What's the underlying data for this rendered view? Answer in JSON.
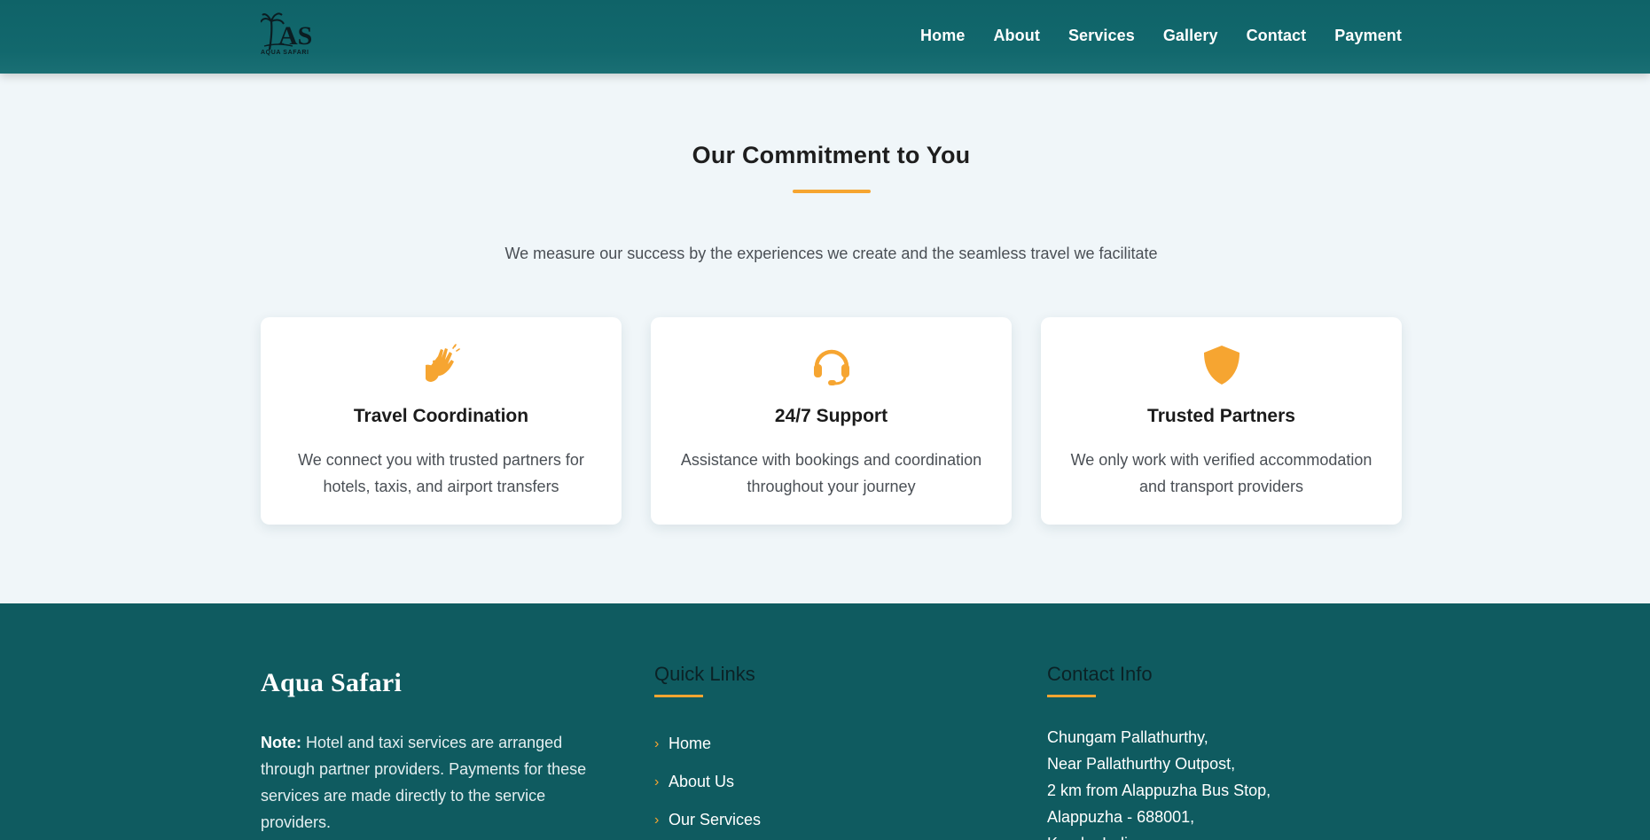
{
  "header": {
    "logo_text": "AQUA SAFARI",
    "nav": [
      "Home",
      "About",
      "Services",
      "Gallery",
      "Contact",
      "Payment"
    ]
  },
  "commitment": {
    "title": "Our Commitment to You",
    "subtitle": "We measure our success by the experiences we create and the seamless travel we facilitate",
    "cards": [
      {
        "icon": "hands-clapping-icon",
        "title": "Travel Coordination",
        "text": "We connect you with trusted partners for hotels, taxis, and airport transfers"
      },
      {
        "icon": "headset-icon",
        "title": "24/7 Support",
        "text": "Assistance with bookings and coordination throughout your journey"
      },
      {
        "icon": "shield-icon",
        "title": "Trusted Partners",
        "text": "We only work with verified accommodation and transport providers"
      }
    ]
  },
  "footer": {
    "brand": "Aqua Safari",
    "note_label": "Note:",
    "note_text": " Hotel and taxi services are arranged through partner providers. Payments for these services are made directly to the service providers.",
    "quick_links_title": "Quick Links",
    "quick_links": [
      "Home",
      "About Us",
      "Our Services"
    ],
    "contact_title": "Contact Info",
    "contact_lines": [
      "Chungam Pallathurthy,",
      "Near Pallathurthy Outpost,",
      "2 km from Alappuzha Bus Stop,",
      "Alappuzha - 688001,",
      "Kerala, India"
    ]
  },
  "colors": {
    "header": "#12686d",
    "footer": "#0f5b60",
    "accent": "#f6a531",
    "background": "#f0f6f9"
  }
}
